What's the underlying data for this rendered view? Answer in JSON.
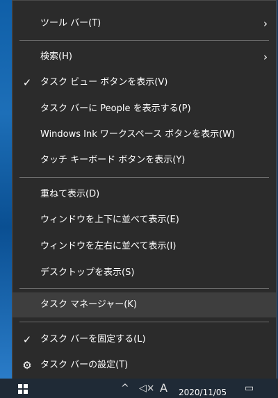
{
  "menu": {
    "toolbar": "ツール バー(T)",
    "search": "検索(H)",
    "task_view": "タスク ビュー ボタンを表示(V)",
    "people": "タスク バーに People を表示する(P)",
    "ink": "Windows Ink ワークスペース ボタンを表示(W)",
    "touch_keyboard": "タッチ キーボード ボタンを表示(Y)",
    "cascade": "重ねて表示(D)",
    "stack": "ウィンドウを上下に並べて表示(E)",
    "side_by_side": "ウィンドウを左右に並べて表示(I)",
    "show_desktop": "デスクトップを表示(S)",
    "task_manager": "タスク マネージャー(K)",
    "lock": "タスク バーを固定する(L)",
    "settings": "タスク バーの設定(T)"
  },
  "glyphs": {
    "check": "✓",
    "chevron": "›",
    "gear": "⚙"
  },
  "taskbar": {
    "date": "2020/11/05",
    "ime": "A"
  },
  "colors": {
    "menu_bg": "#2b2b2b",
    "hover_bg": "#3e3e3e",
    "separator": "#6d6d6d",
    "text": "#ffffff"
  }
}
